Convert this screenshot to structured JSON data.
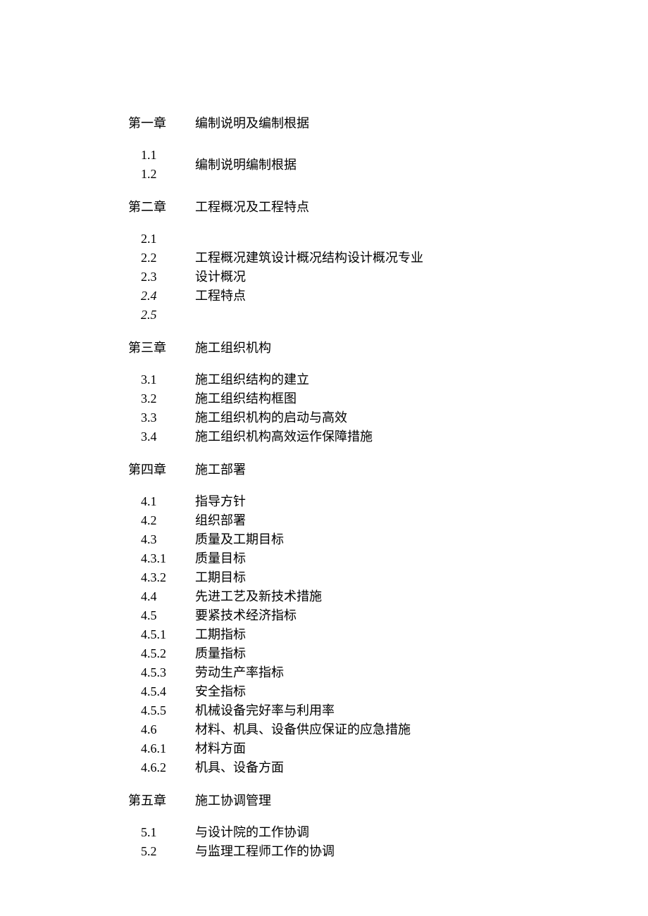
{
  "toc": {
    "chapters": [
      {
        "chapter_num": "第一章",
        "chapter_title": "编制说明及编制根据",
        "item_nums": [
          "1.1",
          "1.2"
        ],
        "item_titles": [
          "编制说明编制根据"
        ],
        "italic_nums": []
      },
      {
        "chapter_num": "第二章",
        "chapter_title": "工程概况及工程特点",
        "item_nums": [
          "2.1",
          "2.2",
          "2.3",
          "2.4",
          "2.5"
        ],
        "item_titles": [
          "工程概况建筑设计概况结构设计概况专业",
          "设计概况",
          "工程特点"
        ],
        "italic_nums": [
          3,
          4
        ]
      },
      {
        "chapter_num": "第三章",
        "chapter_title": "施工组织机构",
        "item_nums": [
          "3.1",
          "3.2",
          "3.3",
          "3.4"
        ],
        "item_titles": [
          "施工组织结构的建立",
          "施工组织结构框图",
          "施工组织机构的启动与高效",
          "施工组织机构高效运作保障措施"
        ],
        "italic_nums": []
      },
      {
        "chapter_num": "第四章",
        "chapter_title": "施工部署",
        "item_nums": [
          "4.1",
          "4.2",
          "4.3",
          "4.3.1",
          "4.3.2",
          "4.4",
          "4.5",
          "4.5.1",
          "4.5.2",
          "4.5.3",
          "4.5.4",
          "4.5.5",
          "4.6",
          "4.6.1",
          "4.6.2"
        ],
        "item_titles": [
          "指导方针",
          "组织部署",
          "质量及工期目标",
          "质量目标",
          "工期目标",
          "先进工艺及新技术措施",
          "要紧技术经济指标",
          "工期指标",
          "质量指标",
          "劳动生产率指标",
          "安全指标",
          "机械设备完好率与利用率",
          "材料、机具、设备供应保证的应急措施",
          "材料方面",
          "机具、设备方面"
        ],
        "italic_nums": []
      },
      {
        "chapter_num": "第五章",
        "chapter_title": "施工协调管理",
        "item_nums": [
          "5.1",
          "5.2"
        ],
        "item_titles": [
          "与设计院的工作协调",
          "与监理工程师工作的协调"
        ],
        "italic_nums": []
      }
    ]
  }
}
